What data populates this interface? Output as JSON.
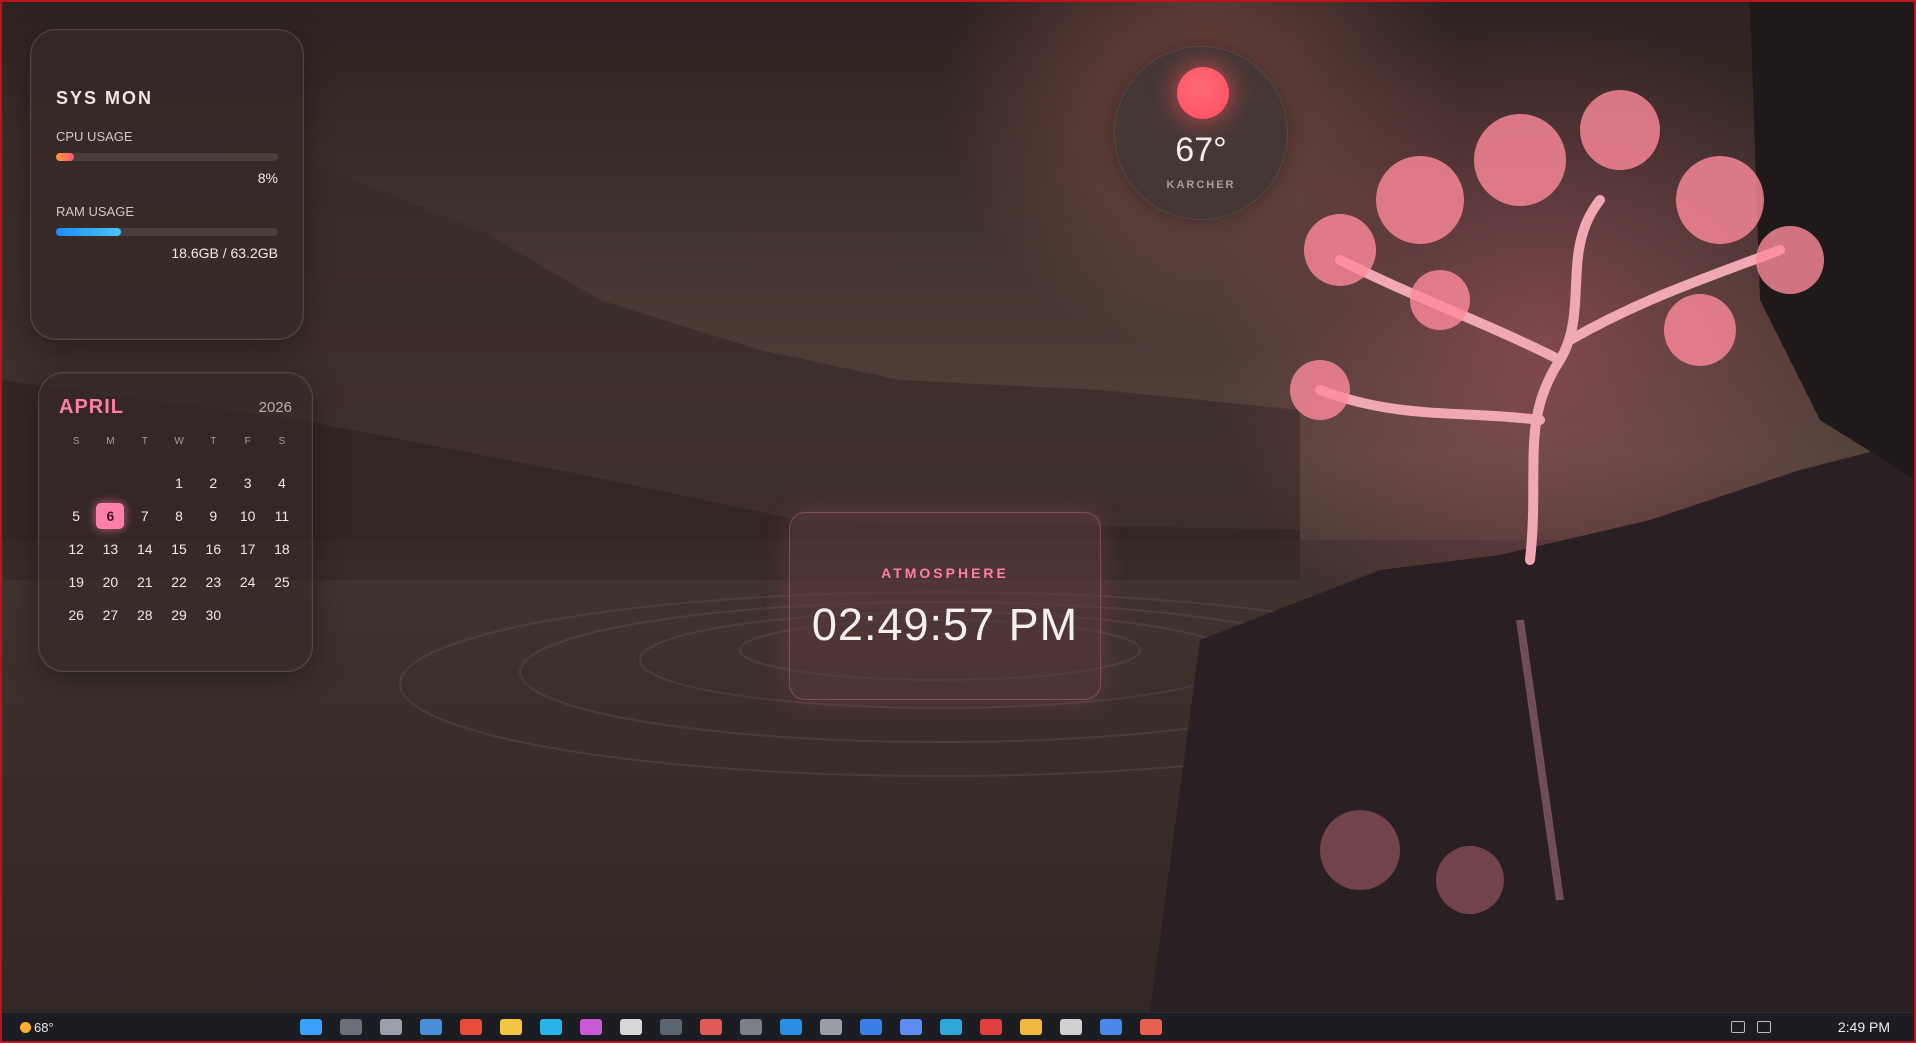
{
  "sysmon": {
    "title": "SYS MON",
    "cpu": {
      "label": "CPU USAGE",
      "value_text": "8%",
      "fraction": 0.08
    },
    "ram": {
      "label": "RAM USAGE",
      "value_text": "18.6GB / 63.2GB",
      "fraction": 0.294
    }
  },
  "calendar": {
    "month": "APRIL",
    "year": "2026",
    "weekdays": [
      "S",
      "M",
      "T",
      "W",
      "T",
      "F",
      "S"
    ],
    "first_weekday": 3,
    "days_in_month": 30,
    "today": 6
  },
  "weather": {
    "temp": "67°",
    "city": "KARCHER"
  },
  "clock": {
    "label": "ATMOSPHERE",
    "time": "02:49:57 PM"
  },
  "taskbar": {
    "weather_temp": "68°",
    "clock": "2:49 PM",
    "icons": [
      {
        "name": "start-icon",
        "color": "#3aa0ff"
      },
      {
        "name": "search-icon",
        "color": "#6a6f7a"
      },
      {
        "name": "taskview-icon",
        "color": "#9aa0aa"
      },
      {
        "name": "widgets-icon",
        "color": "#4a90d9"
      },
      {
        "name": "chrome-icon",
        "color": "#e94b3c"
      },
      {
        "name": "file-explorer-icon",
        "color": "#f4c542"
      },
      {
        "name": "store-icon",
        "color": "#28b4e6"
      },
      {
        "name": "app-icon",
        "color": "#c85ad6"
      },
      {
        "name": "notepad-icon",
        "color": "#d8d8d8"
      },
      {
        "name": "terminal-icon",
        "color": "#5d6670"
      },
      {
        "name": "media-icon",
        "color": "#e05a5a"
      },
      {
        "name": "app-icon",
        "color": "#7a7f88"
      },
      {
        "name": "vscode-icon",
        "color": "#2a8fe0"
      },
      {
        "name": "settings-icon",
        "color": "#9a9ea6"
      },
      {
        "name": "app-icon",
        "color": "#3b7ee8"
      },
      {
        "name": "app-icon",
        "color": "#5b8ef0"
      },
      {
        "name": "edge-icon",
        "color": "#2ea6d8"
      },
      {
        "name": "app-icon",
        "color": "#e04040"
      },
      {
        "name": "folder-icon",
        "color": "#f0b840"
      },
      {
        "name": "app-icon",
        "color": "#d0d0d0"
      },
      {
        "name": "app-icon",
        "color": "#4a88e8"
      },
      {
        "name": "app-icon",
        "color": "#e86050"
      }
    ]
  }
}
